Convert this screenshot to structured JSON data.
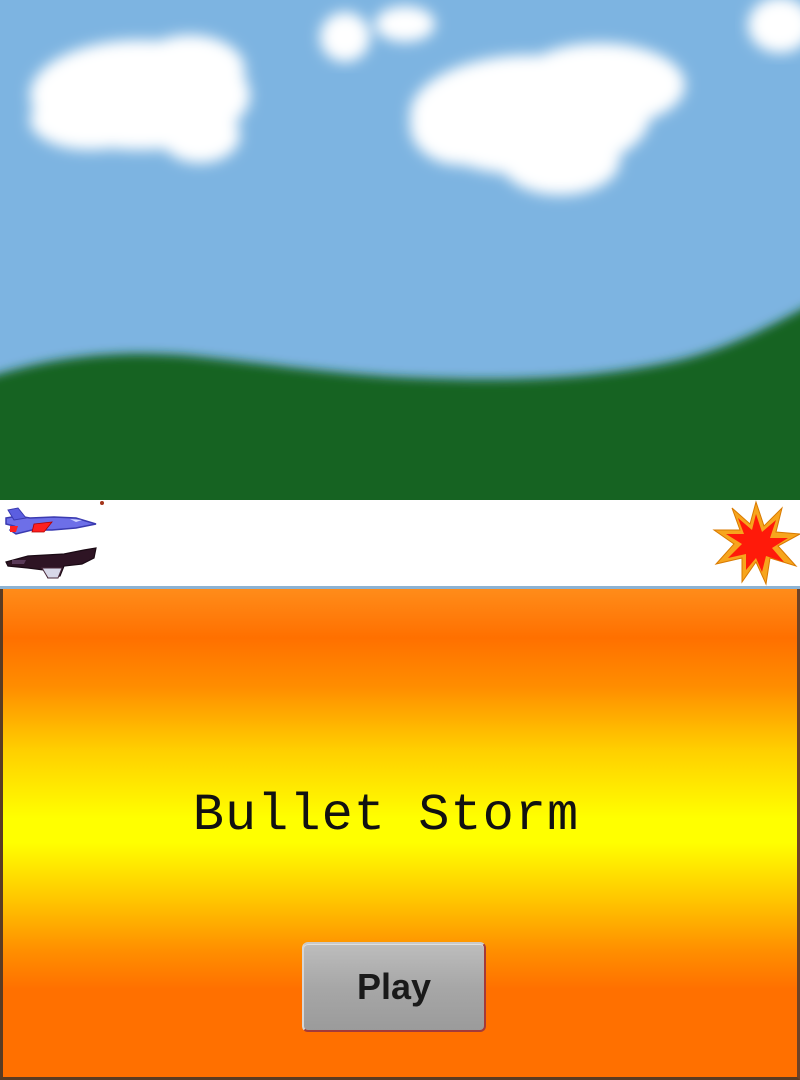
{
  "game": {
    "title": "Bullet Storm",
    "play_label": "Play"
  },
  "sprites": {
    "player_plane": "blue-jet-sprite",
    "enemy_plane": "dark-jet-sprite",
    "explosion": "explosion-sprite",
    "bullet": "bullet-sprite"
  },
  "colors": {
    "sky": "#7db4e1",
    "hills": "#156420",
    "title_gradient_orange": "#ff7000",
    "title_gradient_yellow": "#ffff00",
    "button": "#a7a7a7"
  }
}
